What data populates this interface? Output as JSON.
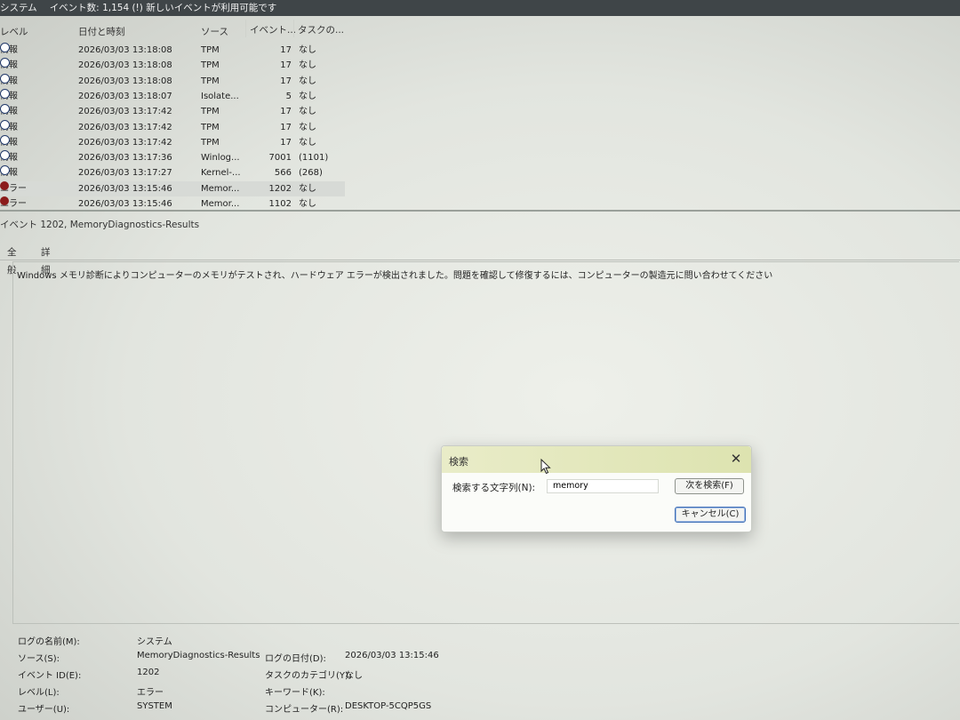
{
  "title": {
    "app": "システム",
    "count": "イベント数: 1,154 (!) 新しいイベントが利用可能です"
  },
  "list": {
    "columns": [
      "レベル",
      "日付と時刻",
      "ソース",
      "イベント...",
      "タスクの..."
    ],
    "rows": [
      {
        "level": "情報",
        "date": "2026/03/03 13:18:08",
        "source": "TPM",
        "id": "17",
        "task": "なし",
        "icon": "info-icon"
      },
      {
        "level": "情報",
        "date": "2026/03/03 13:18:08",
        "source": "TPM",
        "id": "17",
        "task": "なし",
        "icon": "info-icon"
      },
      {
        "level": "情報",
        "date": "2026/03/03 13:18:08",
        "source": "TPM",
        "id": "17",
        "task": "なし",
        "icon": "info-icon"
      },
      {
        "level": "情報",
        "date": "2026/03/03 13:18:07",
        "source": "Isolate...",
        "id": "5",
        "task": "なし",
        "icon": "info-icon"
      },
      {
        "level": "情報",
        "date": "2026/03/03 13:17:42",
        "source": "TPM",
        "id": "17",
        "task": "なし",
        "icon": "info-icon"
      },
      {
        "level": "情報",
        "date": "2026/03/03 13:17:42",
        "source": "TPM",
        "id": "17",
        "task": "なし",
        "icon": "info-icon"
      },
      {
        "level": "情報",
        "date": "2026/03/03 13:17:42",
        "source": "TPM",
        "id": "17",
        "task": "なし",
        "icon": "info-icon"
      },
      {
        "level": "情報",
        "date": "2026/03/03 13:17:36",
        "source": "Winlog...",
        "id": "7001",
        "task": "(1101)",
        "icon": "info-icon"
      },
      {
        "level": "情報",
        "date": "2026/03/03 13:17:27",
        "source": "Kernel-...",
        "id": "566",
        "task": "(268)",
        "icon": "info-icon"
      },
      {
        "level": "エラー",
        "date": "2026/03/03 13:15:46",
        "source": "Memor...",
        "id": "1202",
        "task": "なし",
        "icon": "error-icon"
      },
      {
        "level": "エラー",
        "date": "2026/03/03 13:15:46",
        "source": "Memor...",
        "id": "1102",
        "task": "なし",
        "icon": "error-icon"
      }
    ]
  },
  "event": {
    "header": "イベント 1202, MemoryDiagnostics-Results",
    "tabs": [
      "全般",
      "詳細"
    ],
    "description": "Windows メモリ診断によりコンピューターのメモリがテストされ、ハードウェア エラーが検出されました。問題を確認して修復するには、コンピューターの製造元に問い合わせてください"
  },
  "dialog": {
    "title": "検索",
    "label": "検索する文字列(N):",
    "value": "memory",
    "next": "次を検索(F)",
    "cancel": "キャンセル(C)"
  },
  "props": {
    "log_name_label": "ログの名前(M):",
    "log_name": "システム",
    "source_label": "ソース(S):",
    "source": "MemoryDiagnostics-Results",
    "logged_label": "ログの日付(D):",
    "logged": "2026/03/03 13:15:46",
    "event_id_label": "イベント ID(E):",
    "event_id": "1202",
    "task_label": "タスクのカテゴリ(Y):",
    "task": "なし",
    "level_label": "レベル(L):",
    "level": "エラー",
    "keywords_label": "キーワード(K):",
    "user_label": "ユーザー(U):",
    "user": "SYSTEM",
    "computer_label": "コンピューター(R):",
    "computer": "DESKTOP-5CQP5GS"
  }
}
